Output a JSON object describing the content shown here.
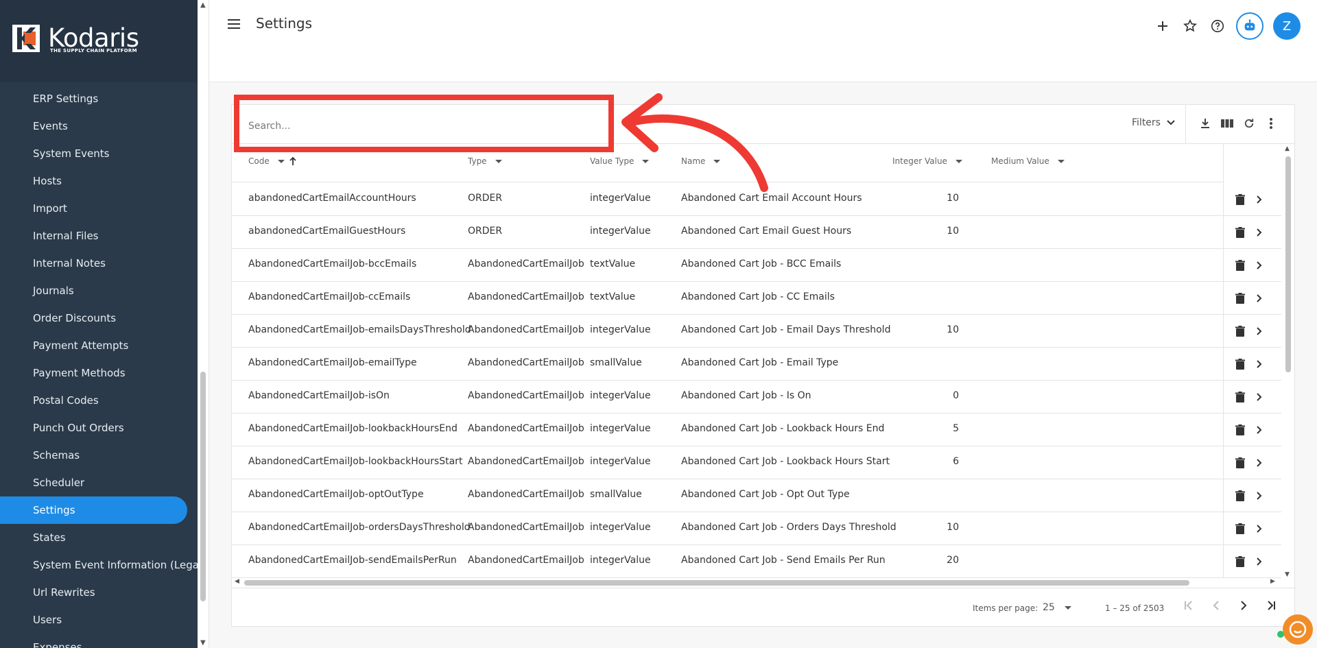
{
  "brand": {
    "name": "Kodaris",
    "tagline": "THE SUPPLY CHAIN PLATFORM",
    "accent": "#1e8ce6",
    "logo_color": "#e8612c"
  },
  "sidebar": {
    "items": [
      {
        "label": "ERP Settings",
        "active": false
      },
      {
        "label": "Events",
        "active": false
      },
      {
        "label": "System Events",
        "active": false
      },
      {
        "label": "Hosts",
        "active": false
      },
      {
        "label": "Import",
        "active": false
      },
      {
        "label": "Internal Files",
        "active": false
      },
      {
        "label": "Internal Notes",
        "active": false
      },
      {
        "label": "Journals",
        "active": false
      },
      {
        "label": "Order Discounts",
        "active": false
      },
      {
        "label": "Payment Attempts",
        "active": false
      },
      {
        "label": "Payment Methods",
        "active": false
      },
      {
        "label": "Postal Codes",
        "active": false
      },
      {
        "label": "Punch Out Orders",
        "active": false
      },
      {
        "label": "Schemas",
        "active": false
      },
      {
        "label": "Scheduler",
        "active": false
      },
      {
        "label": "Settings",
        "active": true
      },
      {
        "label": "States",
        "active": false
      },
      {
        "label": "System Event Information (Legacy)",
        "active": false
      },
      {
        "label": "Url Rewrites",
        "active": false
      },
      {
        "label": "Users",
        "active": false
      },
      {
        "label": "Expenses",
        "active": false
      }
    ]
  },
  "header": {
    "title": "Settings",
    "avatar_initial": "Z",
    "icons": [
      "add-icon",
      "star-icon",
      "help-icon",
      "robot-icon"
    ]
  },
  "search": {
    "placeholder": "Search...",
    "value": ""
  },
  "toolbar": {
    "filters_label": "Filters",
    "icons": [
      "download-icon",
      "columns-icon",
      "refresh-icon",
      "more-vert-icon"
    ]
  },
  "table": {
    "columns": [
      "Code",
      "Type",
      "Value Type",
      "Name",
      "Integer Value",
      "Medium Value"
    ],
    "rows": [
      {
        "code": "abandonedCartEmailAccountHours",
        "type": "ORDER",
        "value_type": "integerValue",
        "name": "Abandoned Cart Email Account Hours",
        "integer": "10"
      },
      {
        "code": "abandonedCartEmailGuestHours",
        "type": "ORDER",
        "value_type": "integerValue",
        "name": "Abandoned Cart Email Guest Hours",
        "integer": "10"
      },
      {
        "code": "AbandonedCartEmailJob-bccEmails",
        "type": "AbandonedCartEmailJob",
        "value_type": "textValue",
        "name": "Abandoned Cart Job - BCC Emails",
        "integer": ""
      },
      {
        "code": "AbandonedCartEmailJob-ccEmails",
        "type": "AbandonedCartEmailJob",
        "value_type": "textValue",
        "name": "Abandoned Cart Job - CC Emails",
        "integer": ""
      },
      {
        "code": "AbandonedCartEmailJob-emailsDaysThreshold",
        "type": "AbandonedCartEmailJob",
        "value_type": "integerValue",
        "name": "Abandoned Cart Job - Email Days Threshold",
        "integer": "10"
      },
      {
        "code": "AbandonedCartEmailJob-emailType",
        "type": "AbandonedCartEmailJob",
        "value_type": "smallValue",
        "name": "Abandoned Cart Job - Email Type",
        "integer": ""
      },
      {
        "code": "AbandonedCartEmailJob-isOn",
        "type": "AbandonedCartEmailJob",
        "value_type": "integerValue",
        "name": "Abandoned Cart Job - Is On",
        "integer": "0"
      },
      {
        "code": "AbandonedCartEmailJob-lookbackHoursEnd",
        "type": "AbandonedCartEmailJob",
        "value_type": "integerValue",
        "name": "Abandoned Cart Job - Lookback Hours End",
        "integer": "5"
      },
      {
        "code": "AbandonedCartEmailJob-lookbackHoursStart",
        "type": "AbandonedCartEmailJob",
        "value_type": "integerValue",
        "name": "Abandoned Cart Job - Lookback Hours Start",
        "integer": "6"
      },
      {
        "code": "AbandonedCartEmailJob-optOutType",
        "type": "AbandonedCartEmailJob",
        "value_type": "smallValue",
        "name": "Abandoned Cart Job - Opt Out Type",
        "integer": ""
      },
      {
        "code": "AbandonedCartEmailJob-ordersDaysThreshold",
        "type": "AbandonedCartEmailJob",
        "value_type": "integerValue",
        "name": "Abandoned Cart Job - Orders Days Threshold",
        "integer": "10"
      },
      {
        "code": "AbandonedCartEmailJob-sendEmailsPerRun",
        "type": "AbandonedCartEmailJob",
        "value_type": "integerValue",
        "name": "Abandoned Cart Job - Send Emails Per Run",
        "integer": "20"
      }
    ]
  },
  "paginator": {
    "items_per_page_label": "Items per page:",
    "page_size": "25",
    "range_label": "1 – 25 of 2503"
  },
  "annotation": {
    "color": "#ee3a32"
  }
}
